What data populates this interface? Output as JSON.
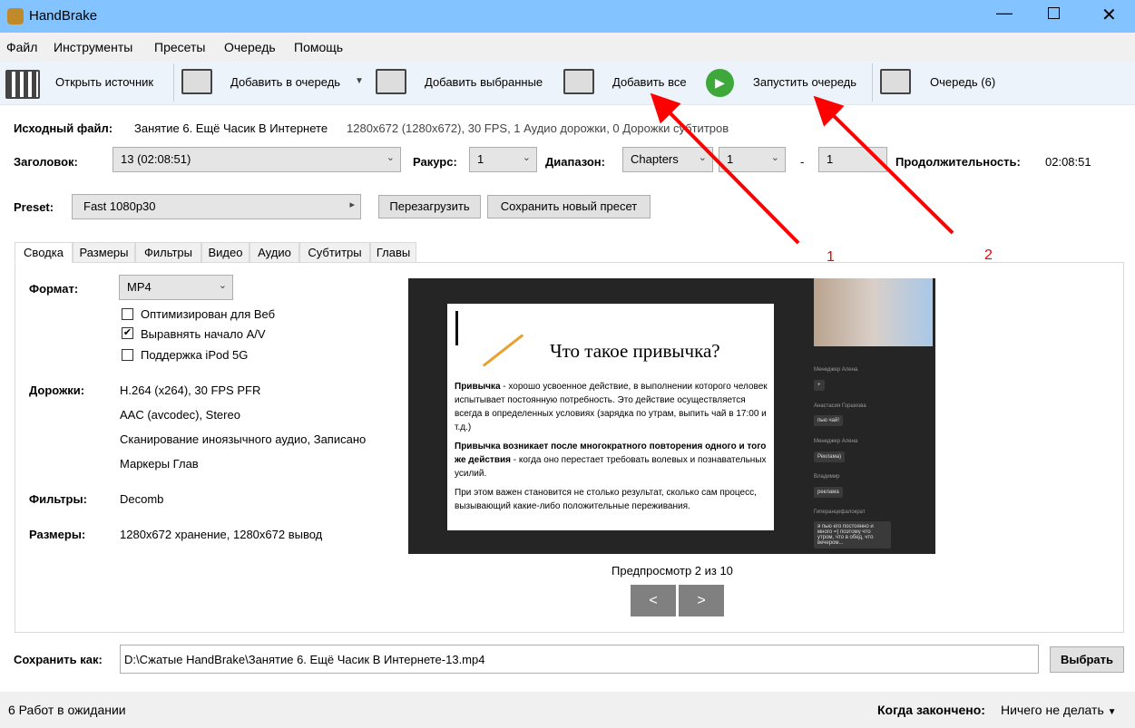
{
  "window": {
    "title": "HandBrake"
  },
  "menu": [
    "Файл",
    "Инструменты",
    "Пресеты",
    "Очередь",
    "Помощь"
  ],
  "toolbar": {
    "open_source": "Открыть источник",
    "add_to_queue": "Добавить в очередь",
    "add_selected": "Добавить выбранные",
    "add_all": "Добавить все",
    "start_queue": "Запустить очередь",
    "queue": "Очередь  (6)"
  },
  "source": {
    "label": "Исходный файл:",
    "name": "Занятие 6. Ещё Часик В Интернете",
    "info": "1280x672 (1280x672), 30 FPS, 1 Аудио дорожки, 0 Дорожки субтитров"
  },
  "title_row": {
    "title_label": "Заголовок:",
    "title_value": "13  (02:08:51)",
    "angle_label": "Ракурс:",
    "angle_value": "1",
    "range_label": "Диапазон:",
    "range_type": "Chapters",
    "range_from": "1",
    "range_sep": "-",
    "range_to": "1",
    "duration_label": "Продолжительность:",
    "duration_value": "02:08:51"
  },
  "preset": {
    "label": "Preset:",
    "value": "Fast 1080p30",
    "reload": "Перезагрузить",
    "save_new": "Сохранить новый пресет"
  },
  "tabs": [
    "Сводка",
    "Размеры",
    "Фильтры",
    "Видео",
    "Аудио",
    "Субтитры",
    "Главы"
  ],
  "summary": {
    "format_label": "Формат:",
    "format_value": "MP4",
    "web_optimized": "Оптимизирован для Веб",
    "web_optimized_checked": false,
    "align_av": "Выравнять начало A/V",
    "align_av_checked": true,
    "ipod": "Поддержка iPod 5G",
    "ipod_checked": false,
    "tracks_label": "Дорожки:",
    "tracks": [
      "H.264 (x264), 30 FPS PFR",
      "AAC (avcodec), Stereo",
      "Сканирование иноязычного аудио, Записано",
      "Маркеры Глав"
    ],
    "filters_label": "Фильтры:",
    "filters_value": "Decomb",
    "sizes_label": "Размеры:",
    "sizes_value": "1280x672 хранение, 1280x672 вывод"
  },
  "preview": {
    "caption": "Предпросмотр 2 из 10",
    "prev": "<",
    "next": ">",
    "slide_title": "Что такое привычка?",
    "p1_bold": "Привычка",
    "p1": " - хорошо усвоенное действие, в выполнении которого человек испытывает постоянную потребность. Это действие осуществляется всегда в определенных условиях (зарядка по утрам, выпить чай в 17:00 и т.д.)",
    "p2_bold": "Привычка возникает после многократного повторения одного и того же действия",
    "p2": " - когда оно перестает требовать волевых и познавательных усилий.",
    "p3": "При этом важен становится не столько результат, сколько сам процесс, вызывающий какие-либо положительные переживания.",
    "chat": [
      {
        "name": "Менеджер Алена",
        "msg": "+"
      },
      {
        "name": "Анастасия Горшкова",
        "msg": "пью чай!"
      },
      {
        "name": "Менеджер Алена",
        "msg": "Реклама)"
      },
      {
        "name": "Владимир",
        "msg": "реклама"
      },
      {
        "name": "Гиперанцефалократ",
        "msg": "я пью его постоянно и много =) поэтому что утром, что в обед, что вечером..."
      }
    ]
  },
  "save": {
    "label": "Сохранить как:",
    "path": "D:\\Сжатые HandBrake\\Занятие 6. Ещё Часик В Интернете-13.mp4",
    "browse": "Выбрать"
  },
  "status": {
    "jobs": "6 Работ в ожидании",
    "when_done_label": "Когда закончено:",
    "when_done_value": "Ничего не делать"
  },
  "annotations": [
    "1",
    "2"
  ],
  "colors": {
    "titlebar": "#83c3ff",
    "arrow": "#ff0000"
  }
}
